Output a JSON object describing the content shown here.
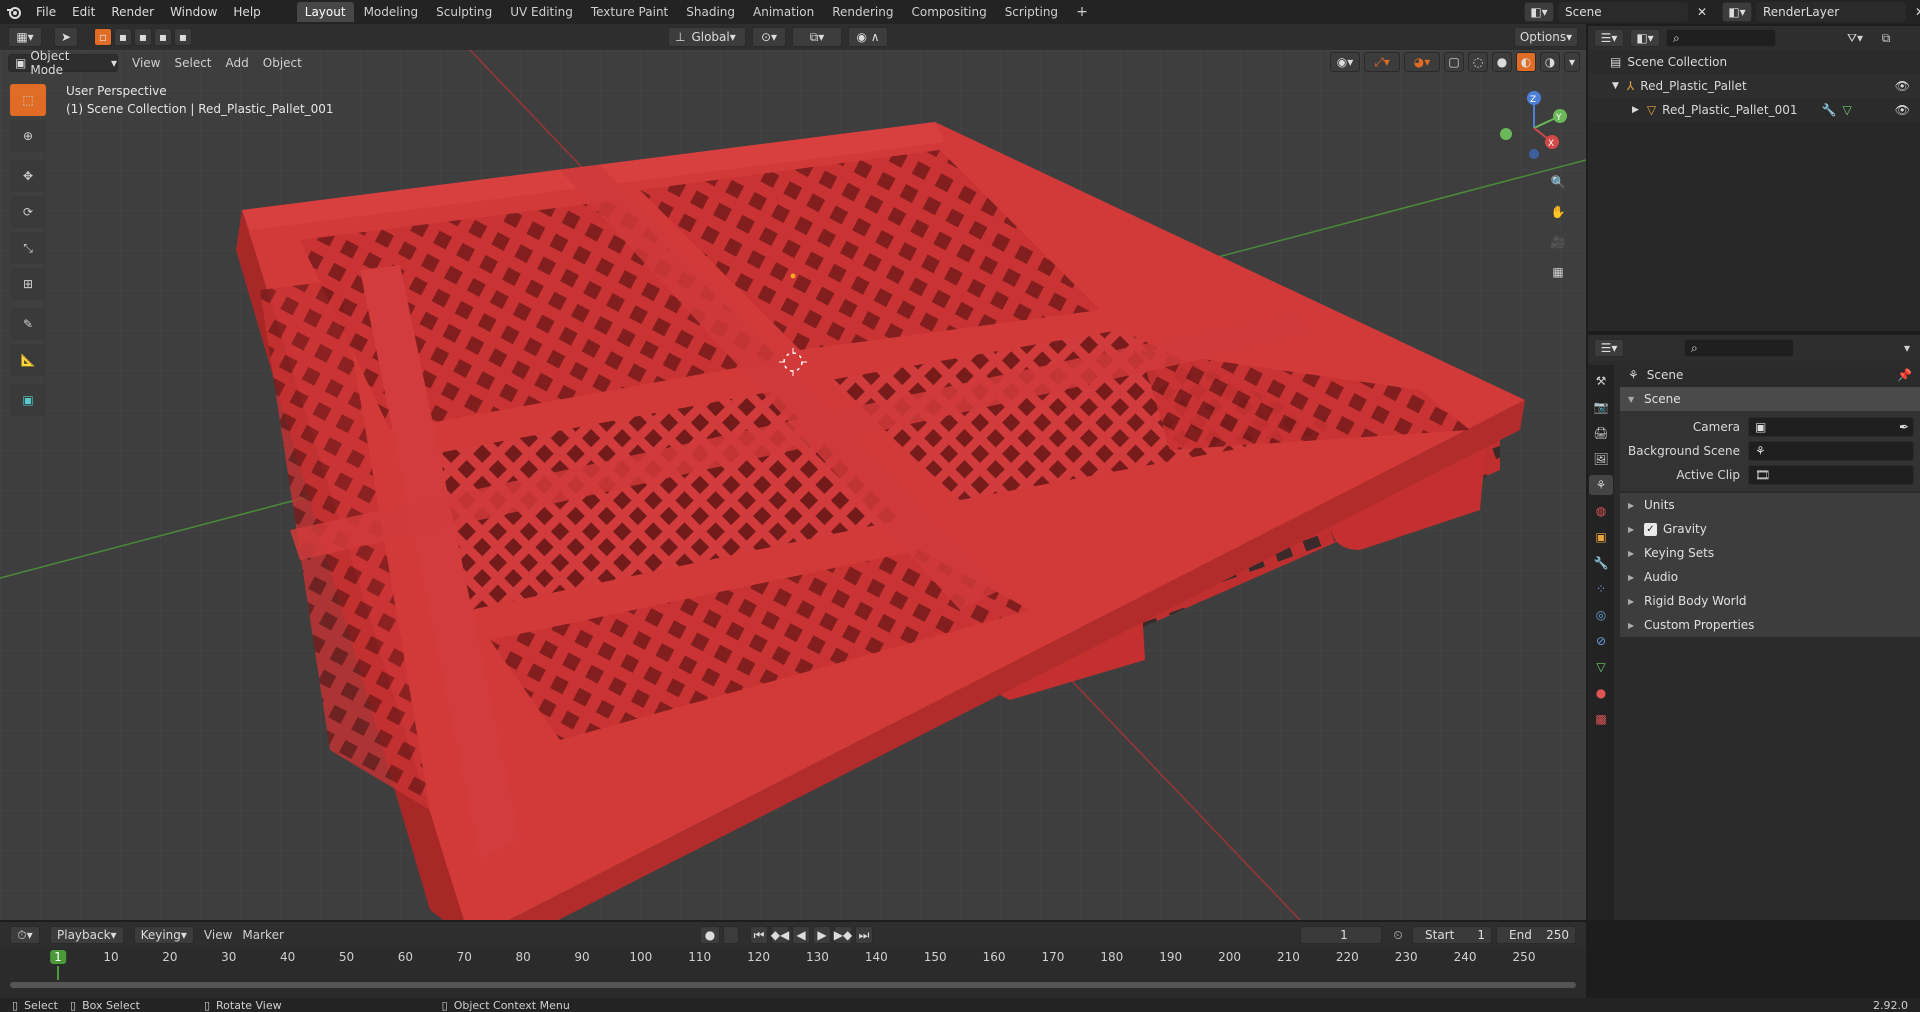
{
  "menu": [
    "File",
    "Edit",
    "Render",
    "Window",
    "Help"
  ],
  "workspaces": [
    "Layout",
    "Modeling",
    "Sculpting",
    "UV Editing",
    "Texture Paint",
    "Shading",
    "Animation",
    "Rendering",
    "Compositing",
    "Scripting"
  ],
  "active_workspace": "Layout",
  "add_tab": "+",
  "scene_name": "Scene",
  "render_layer": "RenderLayer",
  "header": {
    "mode": "Object Mode",
    "menus": [
      "View",
      "Select",
      "Add",
      "Object"
    ],
    "orientation": "Global",
    "options": "Options"
  },
  "viewport": {
    "perspective_label": "User Perspective",
    "context_label": "(1) Scene Collection | Red_Plastic_Pallet_001",
    "gizmo": {
      "x": "X",
      "y": "Y",
      "z": "Z"
    },
    "colors": {
      "pallet": "#d43a3a",
      "bg": "#3e3e3e",
      "x_axis": "#c83a3a",
      "y_axis": "#4ea848"
    }
  },
  "outliner": {
    "root": "Scene Collection",
    "collection": "Red_Plastic_Pallet",
    "object": "Red_Plastic_Pallet_001"
  },
  "properties": {
    "context": "Scene",
    "panel": "Scene",
    "fields": [
      {
        "label": "Camera",
        "value": ""
      },
      {
        "label": "Background Scene",
        "value": ""
      },
      {
        "label": "Active Clip",
        "value": ""
      }
    ],
    "sections": [
      "Units",
      "Gravity",
      "Keying Sets",
      "Audio",
      "Rigid Body World",
      "Custom Properties"
    ],
    "gravity_checked": true
  },
  "timeline": {
    "menus": [
      "Playback",
      "Keying",
      "View",
      "Marker"
    ],
    "current_frame": "1",
    "start_label": "Start",
    "start": "1",
    "end_label": "End",
    "end": "250",
    "ticks": [
      "1",
      "10",
      "20",
      "30",
      "40",
      "50",
      "60",
      "70",
      "80",
      "90",
      "100",
      "110",
      "120",
      "130",
      "140",
      "150",
      "160",
      "170",
      "180",
      "190",
      "200",
      "210",
      "220",
      "230",
      "240",
      "250"
    ]
  },
  "status": {
    "select": "Select",
    "box_select": "Box Select",
    "rotate": "Rotate View",
    "context_menu": "Object Context Menu",
    "version": "2.92.0"
  }
}
